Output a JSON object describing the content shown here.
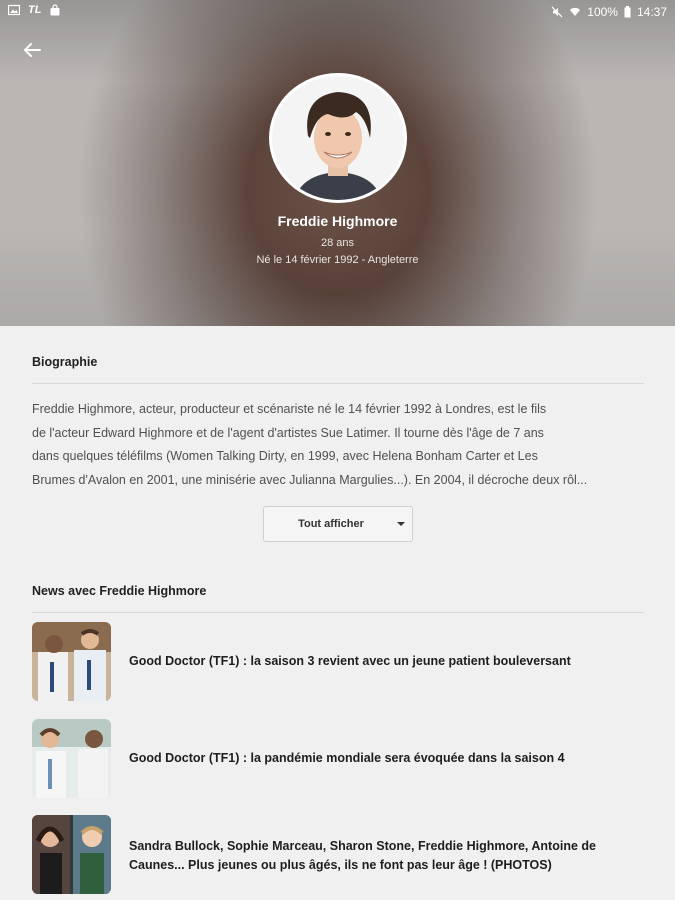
{
  "statusbar": {
    "left_icons": [
      "image-icon",
      "tf1-icon",
      "shopping-bag-icon"
    ],
    "tf1_text": "TL",
    "battery": "100%",
    "time": "14:37"
  },
  "profile": {
    "name": "Freddie Highmore",
    "age": "28 ans",
    "born": "Né le 14 février 1992 - Angleterre"
  },
  "biography": {
    "title": "Biographie",
    "lines": [
      "Freddie Highmore, acteur, producteur et scénariste né le 14 février 1992 à Londres, est le fils",
      "de l'acteur Edward Highmore et de l'agent d'artistes Sue Latimer. Il tourne dès l'âge de 7 ans",
      "dans quelques téléfilms (Women Talking Dirty, en 1999, avec Helena Bonham Carter et Les",
      "Brumes d'Avalon en 2001, une minisérie avec Julianna Margulies...). En 2004, il décroche deux rôl..."
    ],
    "more_label": "Tout afficher"
  },
  "news": {
    "title": "News avec Freddie Highmore",
    "items": [
      {
        "title": "Good Doctor (TF1) : la saison 3 revient avec un jeune patient bouleversant"
      },
      {
        "title": "Good Doctor (TF1) : la pandémie mondiale sera évoquée dans la saison 4"
      },
      {
        "title": "Sandra Bullock, Sophie Marceau, Sharon Stone, Freddie Highmore, Antoine de Caunes... Plus jeunes ou plus âgés, ils ne font pas leur âge ! (PHOTOS)"
      }
    ]
  }
}
